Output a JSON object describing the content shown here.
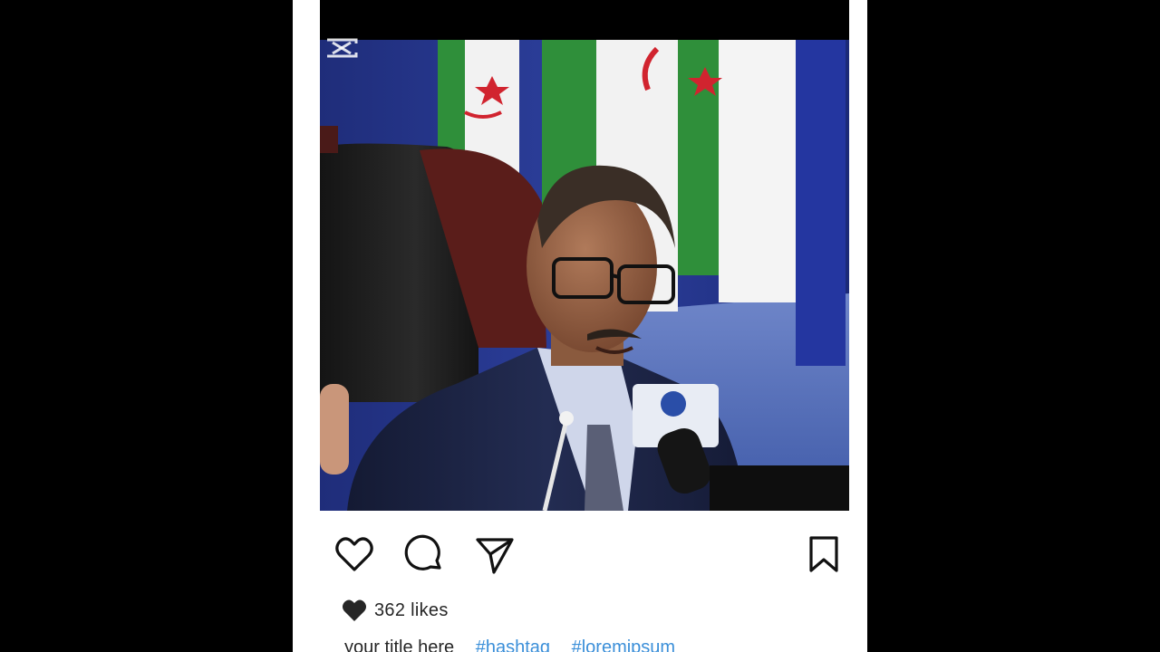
{
  "post": {
    "likes_label": "362 likes",
    "caption_title": "your title here",
    "hashtags": [
      "#hashtag",
      "#loremipsum"
    ]
  },
  "icons": {
    "like": "heart-icon",
    "comment": "comment-bubble-icon",
    "share": "paper-plane-icon",
    "save": "bookmark-icon",
    "likes_indicator": "heart-filled-icon",
    "watermark": "capcut-logo-icon"
  },
  "colors": {
    "background": "#000000",
    "card": "#ffffff",
    "text": "#262626",
    "hashtag": "#3b8fd9",
    "flag_green": "#2f8f3a",
    "flag_red": "#d1242f",
    "curtain_blue": "#2a3a8f"
  }
}
